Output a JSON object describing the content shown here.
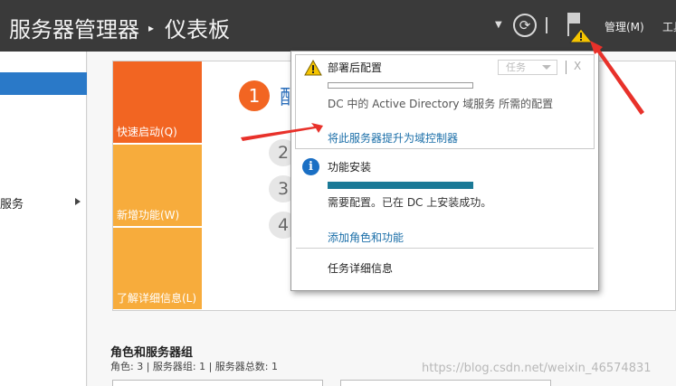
{
  "titlebar": {
    "app_name": "服务器管理器",
    "separator": "▸",
    "page_name": "仪表板",
    "manage_label": "管理(M)",
    "tools_label": "工具"
  },
  "nav": {
    "file_services_label": "服务"
  },
  "welcome": {
    "tiles": [
      "快速启动(Q)",
      "新增功能(W)",
      "了解详细信息(L)"
    ],
    "step1_number": "1",
    "step1_text": "配",
    "step_numbers": [
      "2",
      "3",
      "4"
    ]
  },
  "roles": {
    "title": "角色和服务器组",
    "summary": "角色: 3 | 服务器组: 1 | 服务器总数: 1"
  },
  "notifications": {
    "item1": {
      "title": "部署后配置",
      "tasks_label": "任务",
      "close": "X",
      "description": "DC 中的 Active Directory 域服务 所需的配置",
      "link": "将此服务器提升为域控制器",
      "progress": 0
    },
    "item2": {
      "title": "功能安装",
      "description": "需要配置。已在 DC 上安装成功。",
      "link": "添加角色和功能",
      "progress": 1.0
    },
    "details_label": "任务详细信息"
  },
  "watermark": "https://blog.csdn.net/weixin_46574831",
  "colors": {
    "titlebar_bg": "#3a3a3a",
    "accent_orange": "#f26522",
    "tile_amber": "#f7ac3c",
    "link_blue": "#1a6ea8",
    "progress_teal": "#1b7a97",
    "nav_selected": "#2a79c8",
    "annotation_red": "#e8312a"
  }
}
